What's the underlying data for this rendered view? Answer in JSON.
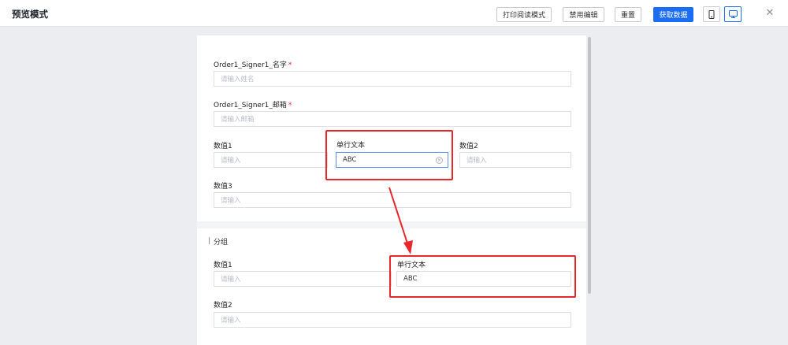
{
  "header": {
    "title": "预览模式",
    "buttons": {
      "print_read_mode": "打印阅读模式",
      "disable_edit": "禁用编辑",
      "reset": "重置",
      "get_data": "获取数据"
    },
    "device_icons": [
      "mobile-icon",
      "desktop-icon"
    ],
    "active_device": "desktop"
  },
  "form": {
    "name_field": {
      "label": "Order1_Signer1_名字",
      "required_mark": "*",
      "placeholder": "请输入姓名"
    },
    "email_field": {
      "label": "Order1_Signer1_邮箱",
      "required_mark": "*",
      "placeholder": "请输入邮箱"
    },
    "value1_field": {
      "label": "数值1",
      "placeholder": "请输入"
    },
    "single_text_field": {
      "label": "单行文本",
      "value": "ABC"
    },
    "value2_field": {
      "label": "数值2",
      "placeholder": "请输入"
    },
    "value3_field": {
      "label": "数值3",
      "placeholder": "请输入"
    }
  },
  "group": {
    "title": "分组",
    "value1_field": {
      "label": "数值1",
      "placeholder": "请输入"
    },
    "single_text_field": {
      "label": "单行文本",
      "value": "ABC"
    },
    "value2_field": {
      "label": "数值2",
      "placeholder": "请输入"
    }
  },
  "colors": {
    "primary": "#1a6df4",
    "annotation": "#e8272a",
    "required": "#f5222d"
  }
}
